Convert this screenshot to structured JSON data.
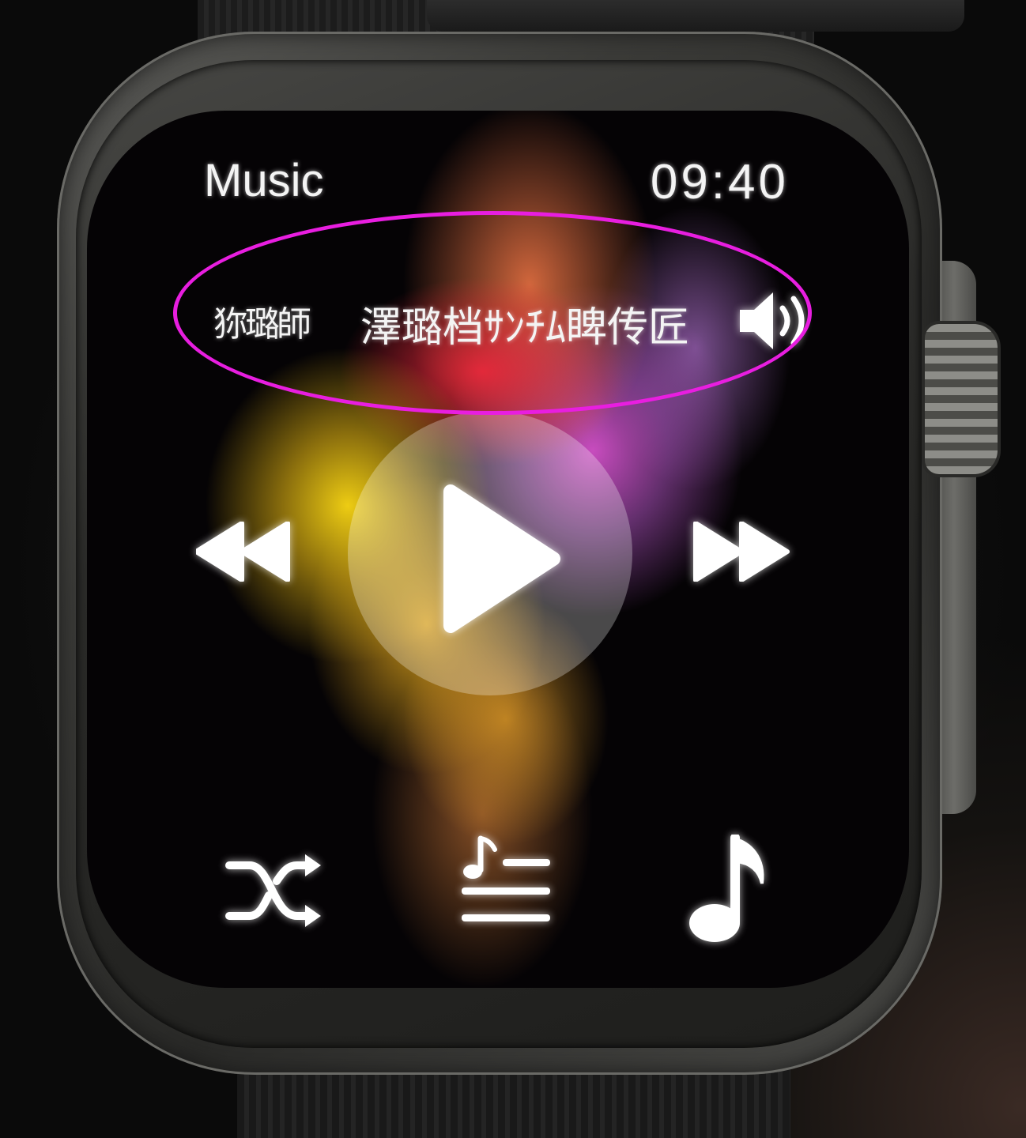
{
  "status_bar": {
    "app_title": "Music",
    "time": "09:40"
  },
  "now_playing": {
    "artist": "狝璐師",
    "title": "澤璐档ｻﾝﾁﾑ睥传匠"
  },
  "icons": {
    "volume": "speaker-volume-icon",
    "previous": "rewind-icon",
    "play": "play-icon",
    "next": "fast-forward-icon",
    "shuffle": "shuffle-icon",
    "playlist": "playlist-icon",
    "library": "music-note-icon"
  },
  "colors": {
    "annotation": "#e81ee0",
    "icon": "#ffffff"
  }
}
